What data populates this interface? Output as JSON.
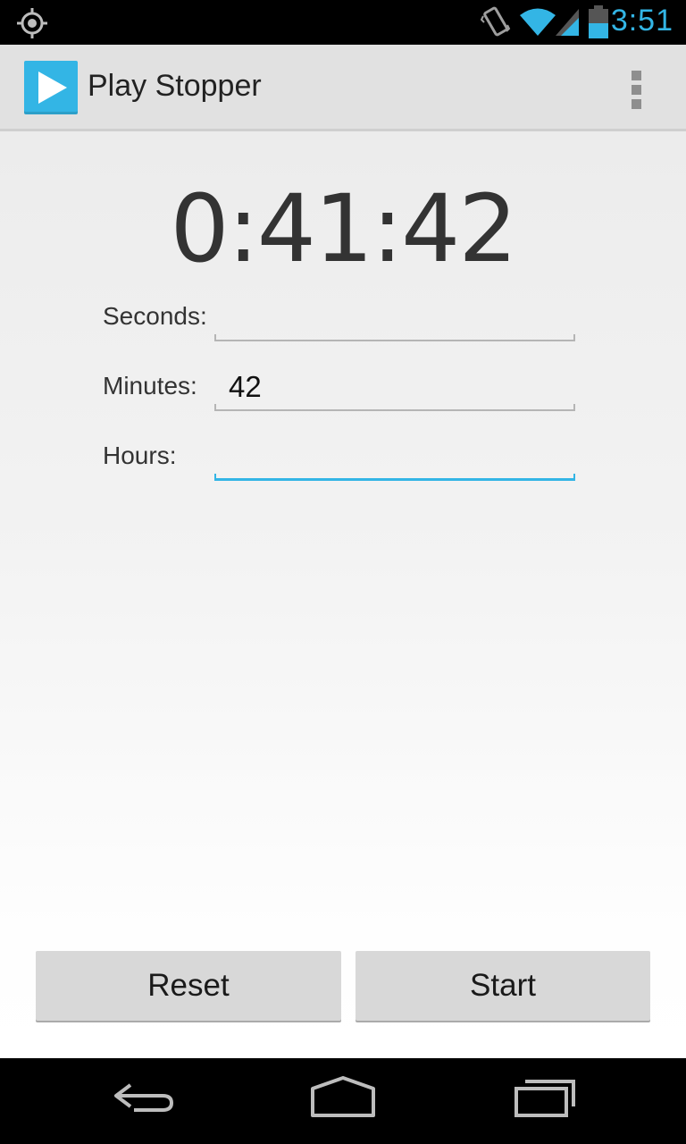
{
  "status_bar": {
    "time": "3:51",
    "icons": [
      "location-icon",
      "vibrate-icon",
      "wifi-icon",
      "signal-icon",
      "battery-icon"
    ],
    "accent_color": "#33b5e5"
  },
  "action_bar": {
    "app_title": "Play Stopper",
    "app_icon": "play-icon",
    "overflow_icon": "overflow-menu-icon"
  },
  "timer": {
    "display": "0:41:42"
  },
  "form": {
    "seconds": {
      "label": "Seconds:",
      "value": ""
    },
    "minutes": {
      "label": "Minutes:",
      "value": "42"
    },
    "hours": {
      "label": "Hours:",
      "value": ""
    }
  },
  "buttons": {
    "reset": "Reset",
    "start": "Start"
  },
  "nav_bar": {
    "icons": [
      "back-icon",
      "home-icon",
      "recent-apps-icon"
    ]
  }
}
